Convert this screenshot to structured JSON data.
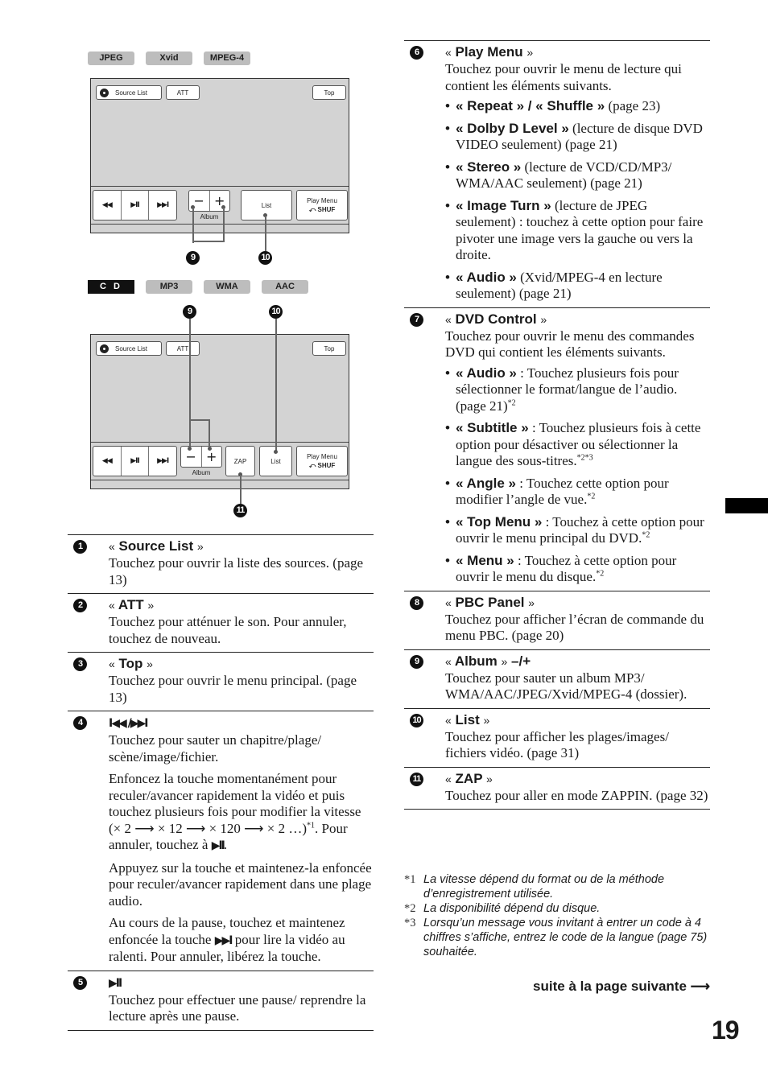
{
  "figure1": {
    "badges": [
      "JPEG",
      "Xvid",
      "MPEG-4"
    ],
    "screen": {
      "source_list": "Source List",
      "att": "ATT",
      "top": "Top",
      "prev_icon": "◀◀",
      "play_pause_icon": "▶II",
      "next_icon": "▶▶I",
      "album_minus": "−",
      "album_plus": "+",
      "album_label": "Album",
      "list": "List",
      "play_menu_line1": "Play Menu",
      "play_menu_line2": "⤺ SHUF"
    },
    "callouts": [
      "9",
      "10"
    ]
  },
  "figure2": {
    "badges": [
      "C D",
      "MP3",
      "WMA",
      "AAC"
    ],
    "screen": {
      "source_list": "Source List",
      "att": "ATT",
      "top": "Top",
      "prev_icon": "◀◀",
      "play_pause_icon": "▶II",
      "next_icon": "▶▶I",
      "album_minus": "−",
      "album_plus": "+",
      "album_label": "Album",
      "zap": "ZAP",
      "list": "List",
      "play_menu_line1": "Play Menu",
      "play_menu_line2": "⤺ SHUF"
    },
    "callouts": [
      "9",
      "10",
      "11"
    ]
  },
  "left_entries": [
    {
      "num": "1",
      "title": "Source List",
      "paras": [
        "Touchez pour ouvrir la liste des sources. (page 13)"
      ]
    },
    {
      "num": "2",
      "title": "ATT",
      "paras": [
        "Touchez pour atténuer le son. Pour annuler, touchez de nouveau."
      ]
    },
    {
      "num": "3",
      "title": "Top",
      "paras": [
        "Touchez pour ouvrir le menu principal. (page 13)"
      ]
    },
    {
      "num": "4",
      "title_symbol": "I◀◀ /▶▶I",
      "paras": [
        "Touchez pour sauter un chapitre/plage/ scène/image/fichier.",
        "Enfoncez la touche momentanément pour reculer/avancer rapidement la vidéo et puis touchez plusieurs fois pour modifier la vitesse (× 2 ⟶ × 12 ⟶ × 120 ⟶ × 2 …)",
        "Appuyez sur la touche et maintenez-la enfoncée pour reculer/avancer rapidement dans une plage audio.",
        "Au cours de la pause, touchez et maintenez enfoncée la touche",
        "pour lire la vidéo au ralenti. Pour annuler, libérez la touche."
      ],
      "para2_note": "*1",
      "para2_tail": ". Pour annuler, touchez à",
      "play_pause_symbol": "▶II",
      "next_symbol": "▶▶I"
    },
    {
      "num": "5",
      "title_symbol": "▶II",
      "paras": [
        "Touchez pour effectuer une pause/ reprendre la lecture après une pause."
      ]
    }
  ],
  "right_entries": [
    {
      "num": "6",
      "title": "Play Menu",
      "paras": [
        "Touchez pour ouvrir le menu de lecture qui contient les éléments suivants."
      ],
      "bullets": [
        {
          "bold": "« Repeat » / « Shuffle »",
          "text": " (page 23)"
        },
        {
          "bold": "« Dolby D Level »",
          "text": " (lecture de disque DVD VIDEO seulement) (page 21)"
        },
        {
          "bold": "« Stereo »",
          "text": " (lecture de VCD/CD/MP3/ WMA/AAC seulement) (page 21)"
        },
        {
          "bold": "« Image Turn »",
          "text": " (lecture de JPEG seulement) : touchez à cette option pour faire pivoter une image vers la gauche ou vers la droite."
        },
        {
          "bold": "« Audio »",
          "text": " (Xvid/MPEG-4 en lecture seulement) (page 21)"
        }
      ]
    },
    {
      "num": "7",
      "title": "DVD Control",
      "paras": [
        "Touchez pour ouvrir le menu des commandes DVD qui contient les éléments suivants."
      ],
      "bullets": [
        {
          "bold": "« Audio »",
          "text": " : Touchez plusieurs fois pour sélectionner le format/langue de l’audio. (page 21)",
          "note": "*2"
        },
        {
          "bold": "« Subtitle »",
          "text": " : Touchez plusieurs fois à cette option pour désactiver ou sélectionner la langue des sous-titres.",
          "note": "*2*3"
        },
        {
          "bold": "« Angle »",
          "text": " : Touchez cette option pour modifier l’angle de vue.",
          "note": "*2"
        },
        {
          "bold": "« Top Menu »",
          "text": " : Touchez à cette option pour ouvrir le menu principal du DVD.",
          "note": "*2"
        },
        {
          "bold": "« Menu »",
          "text": " : Touchez à cette option pour ouvrir le menu du disque.",
          "note": "*2"
        }
      ]
    },
    {
      "num": "8",
      "title": "PBC Panel",
      "paras": [
        "Touchez pour afficher l’écran de commande du menu PBC. (page 20)"
      ]
    },
    {
      "num": "9",
      "title": "Album",
      "title_suffix": " –/+",
      "paras": [
        "Touchez pour sauter un album MP3/ WMA/AAC/JPEG/Xvid/MPEG-4 (dossier)."
      ]
    },
    {
      "num": "10",
      "title": "List",
      "paras": [
        "Touchez pour afficher les plages/images/ fichiers vidéo. (page 31)"
      ]
    },
    {
      "num": "11",
      "title": "ZAP",
      "paras": [
        "Touchez pour aller en mode ZAPPIN. (page 32)"
      ]
    }
  ],
  "quote_open": "« ",
  "quote_close": " »",
  "footnotes": [
    {
      "key": "*1",
      "text": "La vitesse dépend du format ou de la méthode d’enregistrement utilisée."
    },
    {
      "key": "*2",
      "text": "La disponibilité dépend du disque."
    },
    {
      "key": "*3",
      "text": "Lorsqu’un message vous invitant à entrer un code à 4 chiffres s’affiche, entrez le code de la langue (page 75) souhaitée."
    }
  ],
  "continue_label": "suite à la page suivante ⟶",
  "page_number": "19"
}
